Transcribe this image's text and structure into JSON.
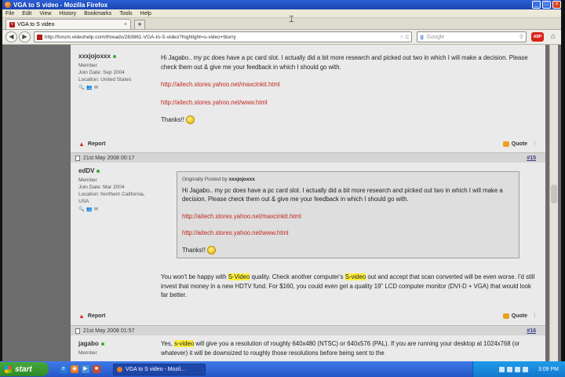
{
  "window": {
    "title": "VGA to S video - Mozilla Firefox",
    "controls": {
      "minimize": "_",
      "maximize": "□",
      "close": "×"
    }
  },
  "menu": [
    "File",
    "Edit",
    "View",
    "History",
    "Bookmarks",
    "Tools",
    "Help"
  ],
  "tabs": [
    {
      "label": "VGA to S video",
      "close": "×"
    }
  ],
  "new_tab": "+",
  "nav": {
    "back": "◀",
    "forward": "▶",
    "url": "http://forum.videohelp.com/threads/283861-VGA-to-S-video?highlight=s-video+blurry",
    "star": "☆",
    "reload": "C",
    "search_engine": "g",
    "search_placeholder": "Google",
    "search_icon": "⚲",
    "adblock": "ABP",
    "home": "⌂"
  },
  "posts": [
    {
      "username": "xxxjojoxxx",
      "rank": "Member",
      "join": "Join Date: Sep 2004",
      "location": "Location: United States",
      "paragraphs": [
        "Hi Jagabo.. my pc does have a pc card slot. I actually did a bit more research and picked out two in which I will make a decision. Please check them out & give me your feedback in which I should go with."
      ],
      "links": [
        "http://aitech.stores.yahoo.net/maxcinkit.html",
        "http://aitech.stores.yahoo.net/www.html"
      ],
      "closing": "Thanks!!",
      "report": "Report",
      "quote": "Quote"
    },
    {
      "date": "21st May 2008 00:17",
      "number": "#15",
      "username": "edDV",
      "rank": "Member",
      "join": "Join Date: Mar 2004",
      "location": "Location: Northern California, USA",
      "quote_by_prefix": "Originally Posted by",
      "quote_by_user": "xxxjojoxxx",
      "quote_text": "Hi Jagabo.. my pc does have a pc card slot. I actually did a bit more research and picked out two in which I will make a decision. Please check them out & give me your feedback in which I should go with.",
      "quote_links": [
        "http://aitech.stores.yahoo.net/maxcinkit.html",
        "http://aitech.stores.yahoo.net/www.html"
      ],
      "quote_closing": "Thanks!!",
      "reply": {
        "t1": "You won't be happy with ",
        "h1": "S-Video",
        "t2": " quality. Check another computer's ",
        "h2": "S-video",
        "t3": " out and accept that scan converted will be even worse. I'd still invest that money in a new HDTV fund. For $160, you could even get a quality 19\" LCD computer monitor (DVI-D + VGA) that would look far better."
      },
      "report": "Report",
      "quote": "Quote"
    },
    {
      "date": "21st May 2008 01:57",
      "number": "#16",
      "username": "jagabo",
      "rank": "Member",
      "reply": {
        "t1": "Yes, ",
        "h1": "s-video",
        "t2": " will give you a resolution of roughly 640x480 (NTSC) or 640x576 (PAL). If you are running your desktop at 1024x768 (or whatever) it will be downsized to roughly those resolutions before being sent to the"
      }
    }
  ],
  "taskbar": {
    "start": "start",
    "task": "VGA to S video - Mozil...",
    "clock": "3:09 PM"
  }
}
